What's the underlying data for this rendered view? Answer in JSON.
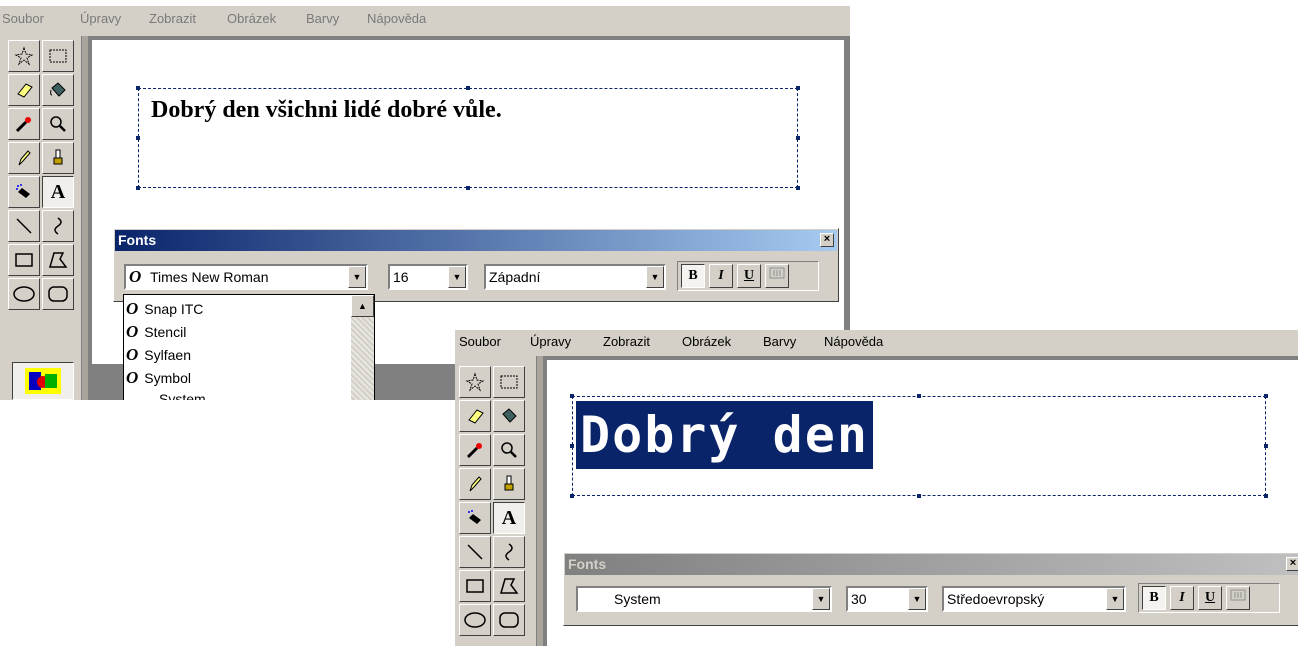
{
  "window1": {
    "menu": [
      "Soubor",
      "Úpravy",
      "Zobrazit",
      "Obrázek",
      "Barvy",
      "Nápověda"
    ],
    "text_content": "Dobrý den všichni lidé dobré vůle.",
    "fonts_toolbar": {
      "title": "Fonts",
      "close": "×",
      "font_name": "Times New Roman",
      "font_size": "16",
      "script": "Západní",
      "bold": "B",
      "italic": "I",
      "underline": "U"
    },
    "font_dropdown": [
      "Snap ITC",
      "Stencil",
      "Sylfaen",
      "Symbol",
      "System"
    ]
  },
  "window2": {
    "menu": [
      "Soubor",
      "Úpravy",
      "Zobrazit",
      "Obrázek",
      "Barvy",
      "Nápověda"
    ],
    "text_content": "Dobrý den",
    "fonts_toolbar": {
      "title": "Fonts",
      "close": "×",
      "font_name": "System",
      "font_size": "30",
      "script": "Středoevropský",
      "bold": "B",
      "italic": "I",
      "underline": "U"
    }
  },
  "colors": {
    "selection": "#0a246a",
    "face": "#d4d0c8",
    "workspace": "#808080"
  }
}
